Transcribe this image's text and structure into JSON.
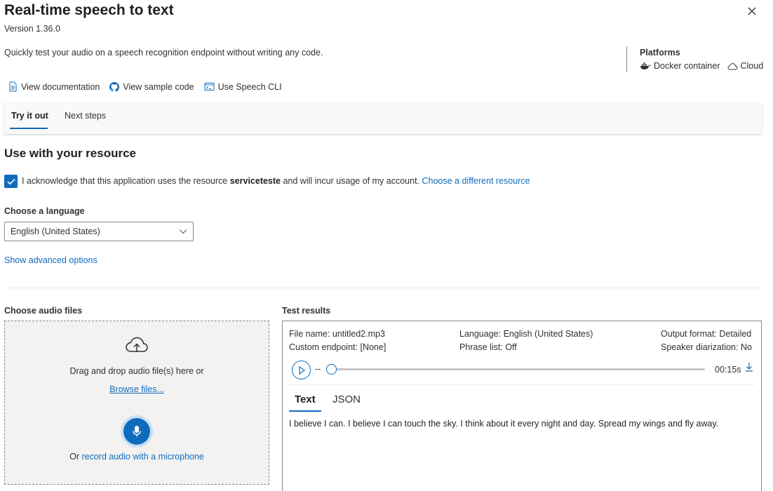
{
  "header": {
    "title": "Real-time speech to text",
    "version": "Version 1.36.0",
    "description": "Quickly test your audio on a speech recognition endpoint without writing any code."
  },
  "platforms": {
    "title": "Platforms",
    "items": [
      "Docker container",
      "Cloud"
    ]
  },
  "links": {
    "documentation": "View documentation",
    "sample_code": "View sample code",
    "speech_cli": "Use Speech CLI"
  },
  "tabs": {
    "try_it_out": "Try it out",
    "next_steps": "Next steps"
  },
  "resource": {
    "section_title": "Use with your resource",
    "ack_before": "I acknowledge that this application uses the resource ",
    "resource_name": "serviceteste",
    "ack_after": " and will incur usage of my account. ",
    "change_link": "Choose a different resource",
    "checked": true
  },
  "language": {
    "label": "Choose a language",
    "selected": "English (United States)",
    "advanced_link": "Show advanced options"
  },
  "audio": {
    "title": "Choose audio files",
    "drag_text": "Drag and drop audio file(s) here or",
    "browse_link": "Browse files...",
    "record_prefix": "Or ",
    "record_link": "record audio with a microphone"
  },
  "results": {
    "title": "Test results",
    "file_name_label": "File name:",
    "file_name": "untitled2.mp3",
    "custom_endpoint_label": "Custom endpoint:",
    "custom_endpoint": "[None]",
    "language_label": "Language:",
    "language": "English (United States)",
    "phrase_list_label": "Phrase list:",
    "phrase_list": "Off",
    "output_format_label": "Output format:",
    "output_format": "Detailed",
    "speaker_diarization_label": "Speaker diarization:",
    "speaker_diarization": "No",
    "player_position": "--",
    "player_duration": "00:15s",
    "tab_text": "Text",
    "tab_json": "JSON",
    "transcript": "I believe I can. I believe I can touch the sky. I think about it every night and day. Spread my wings and fly away."
  },
  "colors": {
    "accent": "#0f6cbd",
    "text": "#323130",
    "dropzone_bg": "#f3f2f1"
  }
}
